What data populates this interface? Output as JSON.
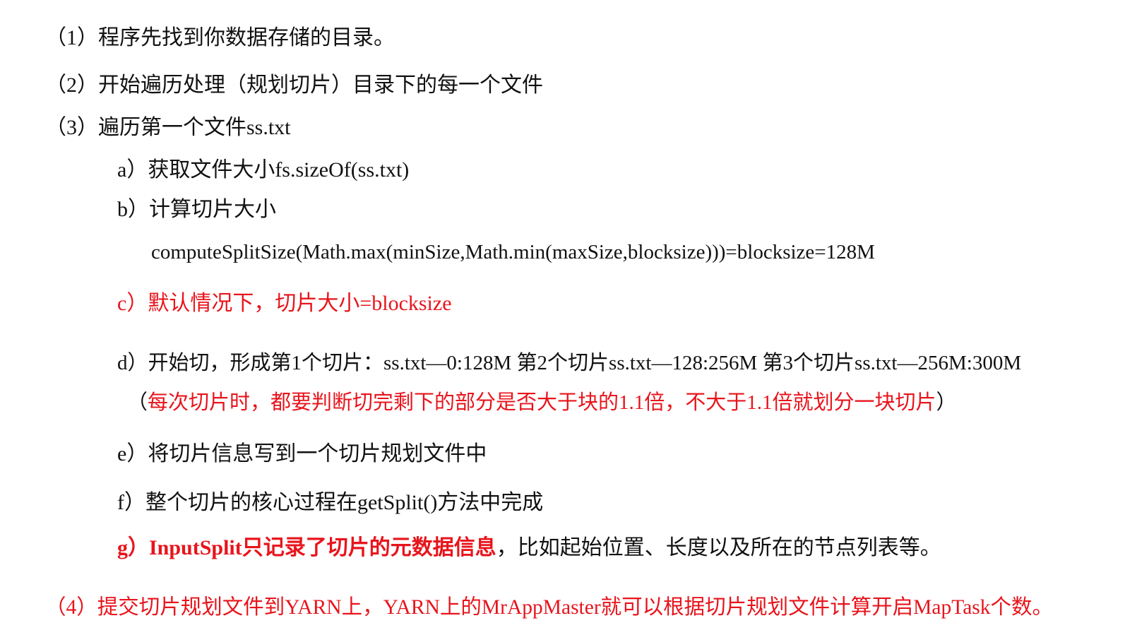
{
  "steps": {
    "step1": "（1）程序先找到你数据存储的目录。",
    "step2": "（2）开始遍历处理（规划切片）目录下的每一个文件",
    "step3": "（3）遍历第一个文件ss.txt",
    "sub_a": "a）获取文件大小fs.sizeOf(ss.txt)",
    "sub_b": "b）计算切片大小",
    "formula": "computeSplitSize(Math.max(minSize,Math.min(maxSize,blocksize)))=blocksize=128M",
    "sub_c": "c）默认情况下，切片大小=blocksize",
    "sub_d": "d）开始切，形成第1个切片：ss.txt—0:128M 第2个切片ss.txt—128:256M 第3个切片ss.txt—256M:300M",
    "sub_d_note": {
      "open_paren": "（",
      "text": "每次切片时，都要判断切完剩下的部分是否大于块的1.1倍，不大于1.1倍就划分一块切片",
      "close_paren": "）"
    },
    "sub_e": "e）将切片信息写到一个切片规划文件中",
    "sub_f": "f）整个切片的核心过程在getSplit()方法中完成",
    "sub_g": {
      "highlight": "g）InputSplit只记录了切片的元数据信息",
      "rest": "，比如起始位置、长度以及所在的节点列表等。"
    },
    "step4": "（4）提交切片规划文件到YARN上，YARN上的MrAppMaster就可以根据切片规划文件计算开启MapTask个数。"
  },
  "colors": {
    "text": "#111111",
    "highlight": "#e8141c"
  }
}
